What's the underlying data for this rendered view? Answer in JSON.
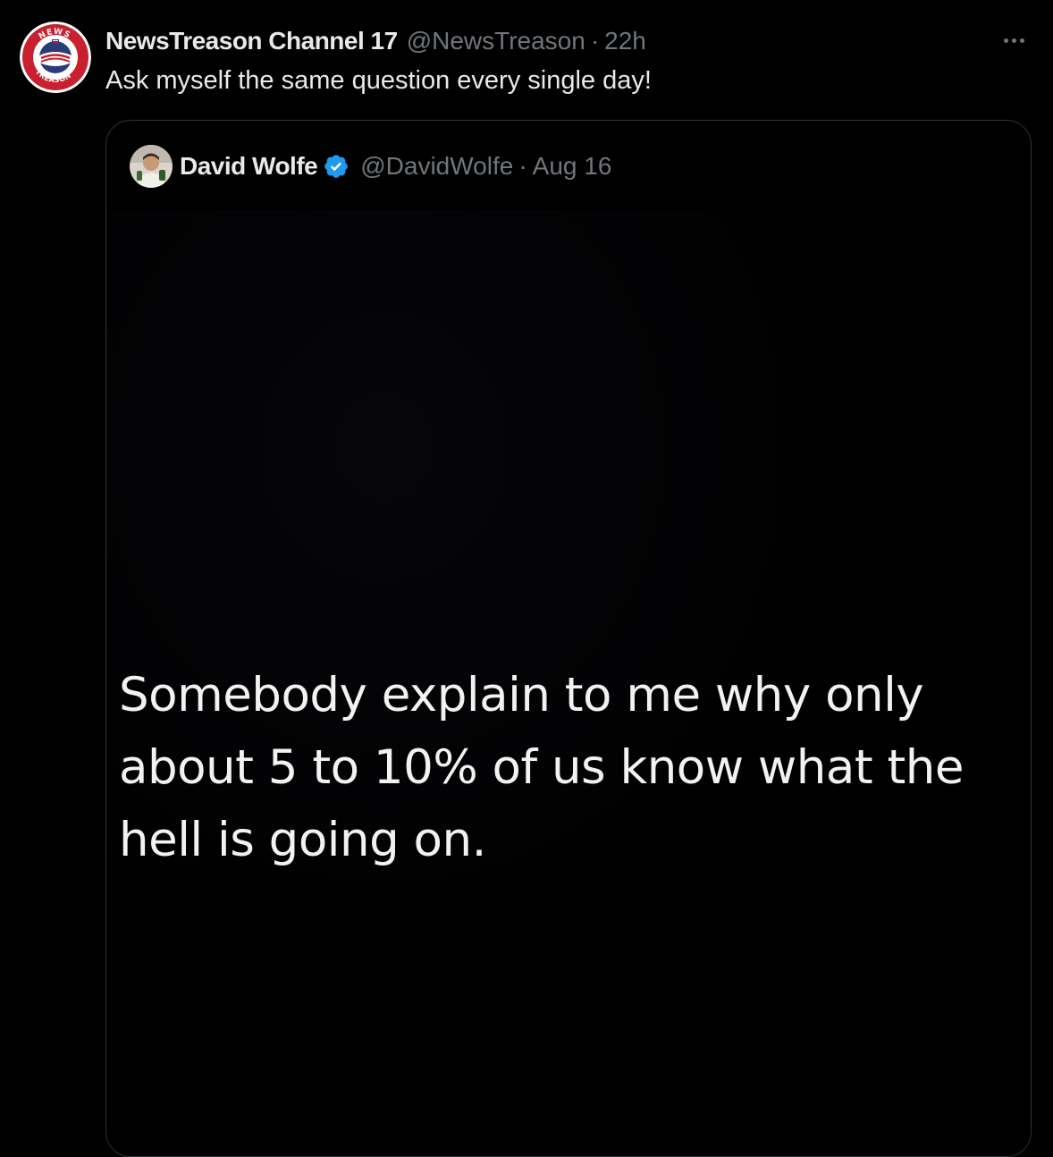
{
  "post": {
    "author_name": "NewsTreason Channel 17",
    "author_handle": "@NewsTreason",
    "separator": "·",
    "time": "22h",
    "text": "Ask myself the same question every single day!",
    "avatar_logo": {
      "top_text": "NEWS",
      "bottom_text": "TREASON"
    },
    "more_icon": "more-horizontal-icon"
  },
  "quoted": {
    "author_name": "David Wolfe",
    "verified_icon": "verified-badge-icon",
    "author_handle": "@DavidWolfe",
    "separator": "·",
    "date": "Aug 16",
    "image_text_lines": [
      "Somebody explain to me why only",
      "about 5 to 10% of us know what the",
      "hell is going on."
    ]
  },
  "colors": {
    "background": "#000000",
    "primary_text": "#e7e9ea",
    "secondary_text": "#71767b",
    "border": "#2f3336",
    "verified_blue": "#1d9bf0",
    "logo_red": "#c8202f"
  }
}
